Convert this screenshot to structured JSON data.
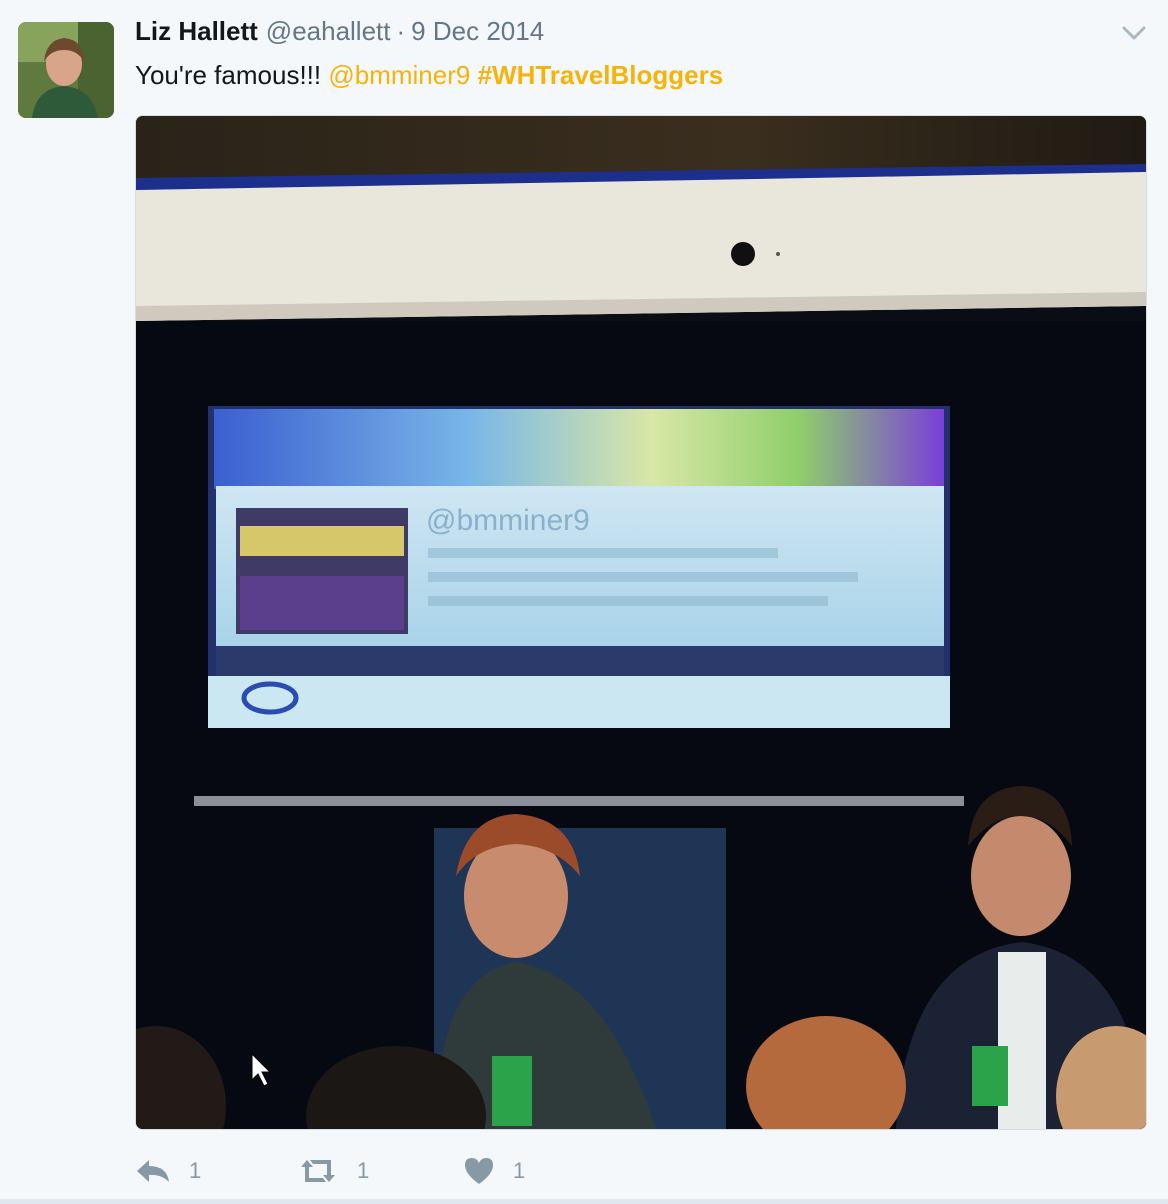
{
  "tweet": {
    "author_name": "Liz Hallett",
    "author_handle": "@eahallett",
    "separator": "·",
    "date": "9 Dec 2014",
    "text_plain": "You're famous!!!",
    "mention": "@bmminer9",
    "hashtag": "#WHTravelBloggers",
    "media_screen_text": "@bmminer9"
  },
  "actions": {
    "reply_count": "1",
    "retweet_count": "1",
    "like_count": "1"
  },
  "colors": {
    "accent": "#f5b30b",
    "muted": "#657786",
    "icon": "#8899a6",
    "background": "#f5f8fa"
  },
  "icons": {
    "caret": "chevron-down-icon",
    "reply": "reply-icon",
    "retweet": "retweet-icon",
    "like": "heart-icon"
  }
}
